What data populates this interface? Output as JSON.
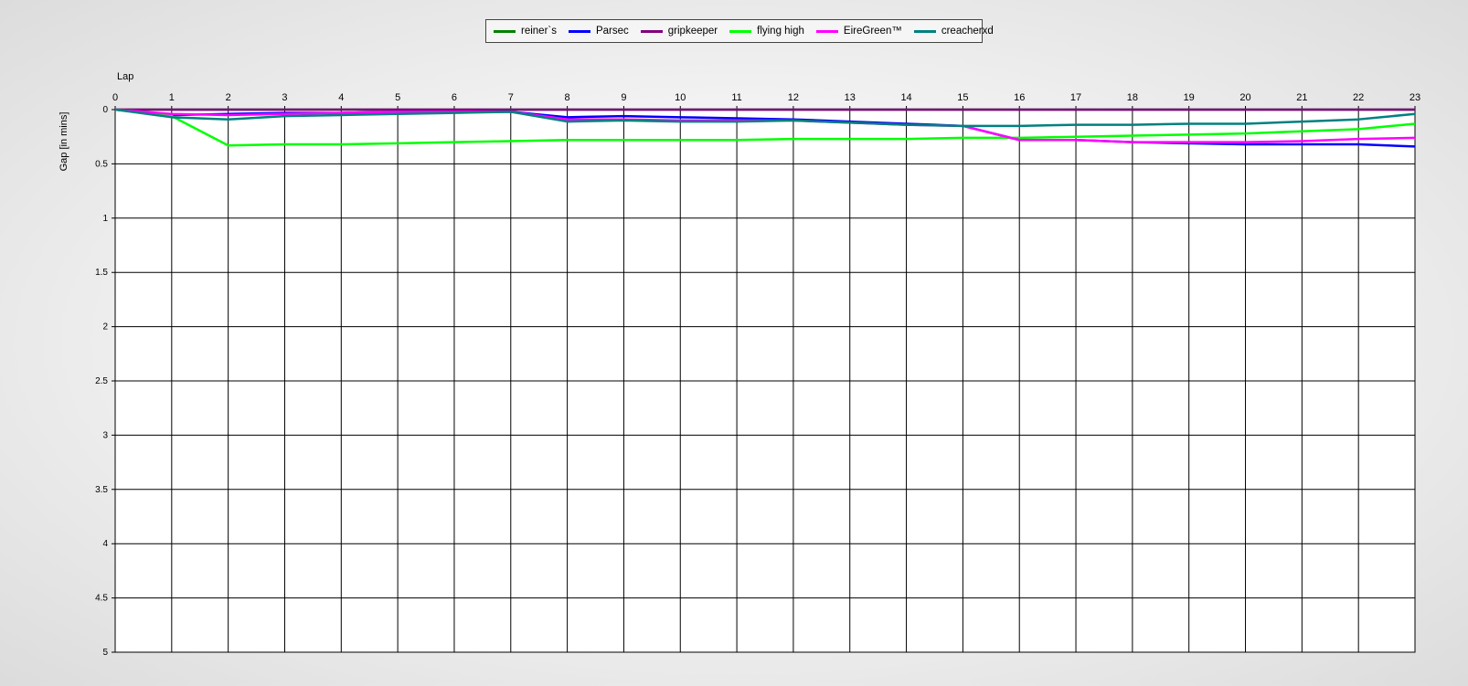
{
  "chart_data": {
    "type": "line",
    "xlabel": "Lap",
    "ylabel": "Gap [in mins]",
    "x": [
      0,
      1,
      2,
      3,
      4,
      5,
      6,
      7,
      8,
      9,
      10,
      11,
      12,
      13,
      14,
      15,
      16,
      17,
      18,
      19,
      20,
      21,
      22,
      23
    ],
    "xticks": [
      "0",
      "1",
      "2",
      "3",
      "4",
      "5",
      "6",
      "7",
      "8",
      "9",
      "10",
      "11",
      "12",
      "13",
      "14",
      "15",
      "16",
      "17",
      "18",
      "19",
      "20",
      "21",
      "22",
      "23"
    ],
    "xlim": [
      0,
      23
    ],
    "ylim": [
      0,
      5
    ],
    "y_inverted": true,
    "yticks": [
      "0",
      "0.5",
      "1",
      "1.5",
      "2",
      "2.5",
      "3",
      "3.5",
      "4",
      "4.5",
      "5"
    ],
    "ytick_values": [
      0,
      0.5,
      1,
      1.5,
      2,
      2.5,
      3,
      3.5,
      4,
      4.5,
      5
    ],
    "x_axis_position": "top",
    "grid": true,
    "legend_position": "top-center",
    "series": [
      {
        "name": "reiner`s",
        "color": "#008000",
        "values": [
          0,
          0,
          0,
          0,
          0,
          0,
          0,
          0,
          0,
          0,
          0,
          0,
          0,
          0,
          0,
          0,
          0,
          0,
          0,
          0,
          0,
          0,
          0,
          0
        ]
      },
      {
        "name": "Parsec",
        "color": "#0000ff",
        "values": [
          0,
          0.05,
          0.04,
          0.03,
          0.03,
          0.02,
          0.02,
          0.02,
          0.07,
          0.06,
          0.07,
          0.08,
          0.09,
          0.11,
          0.13,
          0.15,
          0.28,
          0.28,
          0.3,
          0.31,
          0.32,
          0.32,
          0.32,
          0.34
        ]
      },
      {
        "name": "gripkeeper",
        "color": "#800080",
        "values": [
          0,
          0,
          0,
          0,
          0,
          0,
          0,
          0,
          0,
          0,
          0,
          0,
          0,
          0,
          0,
          0,
          0,
          0,
          0,
          0,
          0,
          0,
          0,
          0
        ]
      },
      {
        "name": "flying high",
        "color": "#00ff00",
        "values": [
          0,
          0.06,
          0.33,
          0.32,
          0.32,
          0.31,
          0.3,
          0.29,
          0.28,
          0.28,
          0.28,
          0.28,
          0.27,
          0.27,
          0.27,
          0.26,
          0.26,
          0.25,
          0.24,
          0.23,
          0.22,
          0.2,
          0.18,
          0.13
        ]
      },
      {
        "name": "EireGreen™",
        "color": "#ff00ff",
        "values": [
          0,
          0.04,
          0.05,
          0.04,
          0.03,
          0.02,
          0.02,
          0.02,
          0.09,
          0.09,
          0.1,
          0.1,
          0.1,
          0.12,
          0.14,
          0.15,
          0.28,
          0.28,
          0.3,
          0.3,
          0.3,
          0.29,
          0.27,
          0.26
        ]
      },
      {
        "name": "creacherxd",
        "color": "#008080",
        "values": [
          0,
          0.07,
          0.09,
          0.06,
          0.05,
          0.04,
          0.03,
          0.02,
          0.11,
          0.1,
          0.11,
          0.11,
          0.1,
          0.12,
          0.14,
          0.15,
          0.15,
          0.14,
          0.14,
          0.13,
          0.13,
          0.11,
          0.09,
          0.04
        ]
      }
    ]
  }
}
